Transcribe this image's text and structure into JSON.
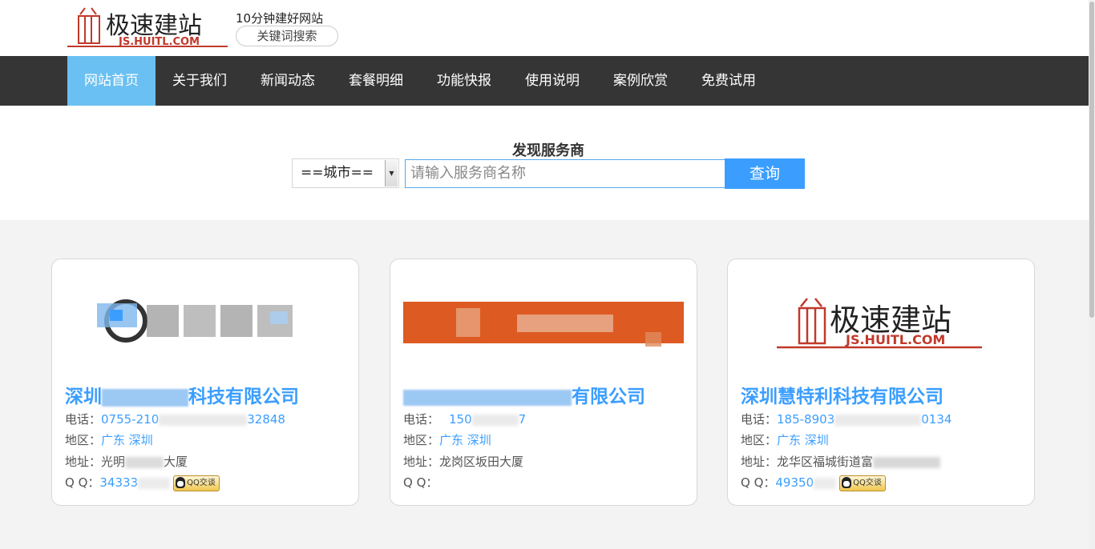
{
  "header": {
    "logo_cn": "极速建站",
    "logo_en": "JS.HUITL.COM",
    "slogan": "10分钟建好网站",
    "keyword_search": "关键词搜索"
  },
  "nav": {
    "items": [
      {
        "label": "网站首页",
        "active": true
      },
      {
        "label": "关于我们"
      },
      {
        "label": "新闻动态"
      },
      {
        "label": "套餐明细"
      },
      {
        "label": "功能快报"
      },
      {
        "label": "使用说明"
      },
      {
        "label": "案例欣赏"
      },
      {
        "label": "免费试用"
      }
    ]
  },
  "search": {
    "title": "发现服务商",
    "city_select": "==城市==",
    "name_placeholder": "请输入服务商名称",
    "query_button": "查询"
  },
  "labels": {
    "phone": "电话：",
    "region": "地区：",
    "address": "地址：",
    "qq": "Q Q：",
    "qq_chat": "QQ交谈"
  },
  "cards": [
    {
      "name_prefix": "深圳",
      "name_suffix": "科技有限公司",
      "phone_start": "0755-210",
      "phone_end": "32848",
      "region": "广东  深圳",
      "address_start": "光明",
      "address_end": "大厦",
      "qq": "34333"
    },
    {
      "name_suffix": "有限公司",
      "phone_start": "150",
      "phone_end": "7",
      "region": "广东  深圳",
      "address": "龙岗区坂田大厦",
      "qq": ""
    },
    {
      "name": "深圳慧特利科技有限公司",
      "logo_cn": "极速建站",
      "logo_en": "JS.HUITL.COM",
      "phone_start": "185-8903",
      "phone_end": "0134",
      "region": "广东  深圳",
      "address_start": "龙华区福城街道富",
      "qq": "49350"
    }
  ],
  "colors": {
    "accent": "#3b9eff",
    "nav_bg": "#353535",
    "nav_active": "#6ac0f2",
    "logo_red": "#c0392b",
    "orange_banner": "#dd5a22"
  }
}
